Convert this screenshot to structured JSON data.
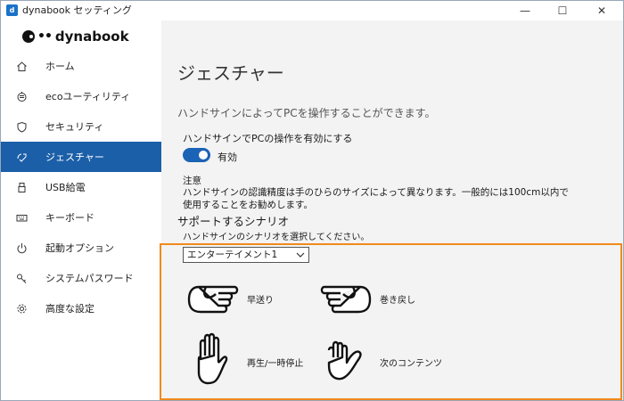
{
  "window": {
    "app_icon_letter": "d",
    "title": "dynabook セッティング",
    "minimize_glyph": "—",
    "maximize_glyph": "☐",
    "close_glyph": "✕"
  },
  "sidebar": {
    "logo_text": "dynabook",
    "items": [
      {
        "label": "ホーム",
        "icon": "home-icon"
      },
      {
        "label": "ecoユーティリティ",
        "icon": "eco-icon"
      },
      {
        "label": "セキュリティ",
        "icon": "shield-icon"
      },
      {
        "label": "ジェスチャー",
        "icon": "gesture-icon",
        "active": true
      },
      {
        "label": "USB給電",
        "icon": "usb-icon"
      },
      {
        "label": "キーボード",
        "icon": "keyboard-icon"
      },
      {
        "label": "起動オプション",
        "icon": "power-icon"
      },
      {
        "label": "システムパスワード",
        "icon": "key-icon"
      },
      {
        "label": "高度な設定",
        "icon": "gear-icon"
      }
    ]
  },
  "main": {
    "title": "ジェスチャー",
    "description": "ハンドサインによってPCを操作することができます。",
    "toggle_heading": "ハンドサインでPCの操作を有効にする",
    "toggle_state": "on",
    "toggle_label": "有効",
    "note_title": "注意",
    "note_text": "ハンドサインの認識精度は手のひらのサイズによって異なります。一般的には100cm以内で使用することをお勧めします。",
    "section_title": "サポートするシナリオ",
    "section_desc": "ハンドサインのシナリオを選択してください。",
    "scenario_selected": "エンターテイメント1",
    "gestures": [
      {
        "label": "早送り",
        "icon": "hand-point-right-icon"
      },
      {
        "label": "巻き戻し",
        "icon": "hand-point-left-icon"
      },
      {
        "label": "再生/一時停止",
        "icon": "open-palm-icon"
      },
      {
        "label": "次のコンテンツ",
        "icon": "hand-cup-icon"
      }
    ]
  },
  "colors": {
    "accent": "#1b5fa8",
    "toggle": "#1b63b5",
    "highlight": "#f08a1c"
  }
}
